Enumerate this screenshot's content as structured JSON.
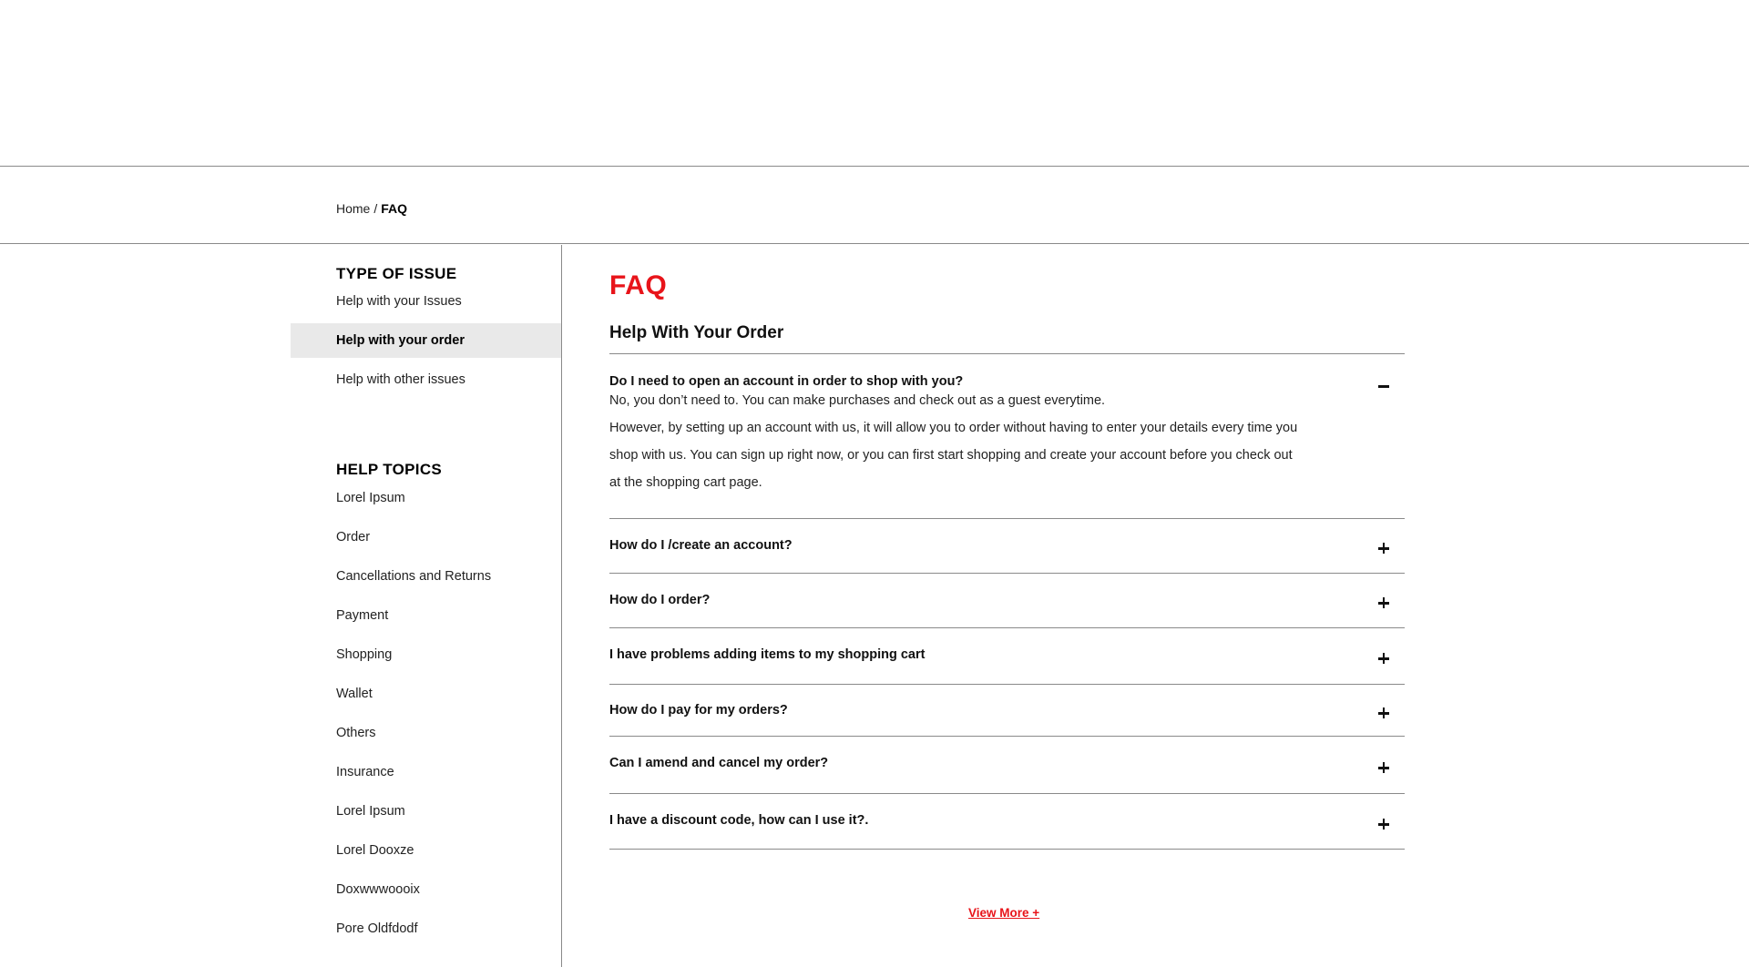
{
  "breadcrumb": {
    "home": "Home",
    "separator": "/",
    "current": "FAQ"
  },
  "sidebar": {
    "issue_heading": "TYPE OF ISSUE",
    "issues": [
      {
        "label": "Help with your Issues",
        "active": false
      },
      {
        "label": "Help with your order",
        "active": true
      },
      {
        "label": "Help with other issues",
        "active": false
      }
    ],
    "topics_heading": "HELP TOPICS",
    "topics": [
      "Lorel Ipsum",
      "Order",
      "Cancellations and Returns",
      "Payment",
      "Shopping",
      "Wallet",
      "Others",
      "Insurance",
      "Lorel Ipsum",
      "Lorel Dooxze",
      "Doxwwwoooix",
      "Pore Oldfdodf"
    ]
  },
  "main": {
    "title": "FAQ",
    "section_title": "Help With Your Order",
    "faqs": [
      {
        "question": "Do I need to open an account in order to shop with you?",
        "expanded": true,
        "answer": [
          "No, you don’t need to. You can make purchases and check out as a guest everytime.",
          "However, by setting up an account with us, it will allow you to order without having to enter your details every time you shop with us. You can sign up right now, or you can first start shopping and create your account before you check out at the shopping cart page."
        ]
      },
      {
        "question": "How do I /create an account?",
        "expanded": false
      },
      {
        "question": "How do I order?",
        "expanded": false
      },
      {
        "question": "I have problems adding items to my shopping cart",
        "expanded": false
      },
      {
        "question": "How do I pay for my orders?",
        "expanded": false
      },
      {
        "question": "Can I amend and cancel my order?",
        "expanded": false
      },
      {
        "question": "I have a discount code, how can I use it?.",
        "expanded": false
      }
    ],
    "view_more": "View More +"
  },
  "colors": {
    "accent": "#e8141a",
    "active_bg": "#e9e9e9",
    "rule": "#8a8a8a"
  }
}
